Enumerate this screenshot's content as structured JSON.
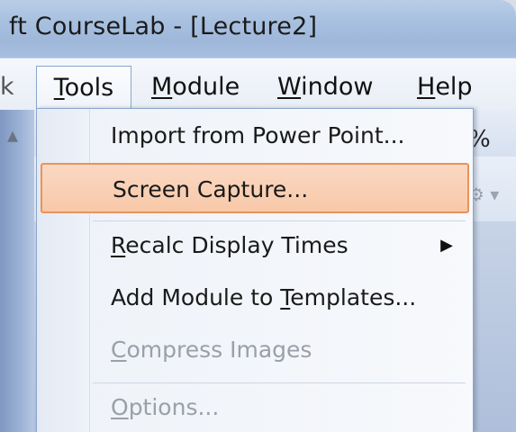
{
  "window": {
    "title": "ft CourseLab - [Lecture2]"
  },
  "menubar": {
    "left_stub": "k",
    "items": [
      {
        "id": "tools",
        "label_ul": "T",
        "label_rest": "ools"
      },
      {
        "id": "module",
        "label_ul": "M",
        "label_rest": "odule"
      },
      {
        "id": "window",
        "label_ul": "W",
        "label_rest": "indow"
      },
      {
        "id": "help",
        "label_ul": "H",
        "label_rest": "elp"
      }
    ]
  },
  "toolbar": {
    "left_stub": "▴",
    "percent_stub": "%",
    "right_icon_stub": "⚙ ▾"
  },
  "dropdown": {
    "items": [
      {
        "id": "import",
        "pre": "Import from Power Point...",
        "ul": "",
        "post": "",
        "enabled": true,
        "selected": false,
        "submenu": false
      },
      {
        "id": "screen-capture",
        "pre": "Screen Capture...",
        "ul": "",
        "post": "",
        "enabled": true,
        "selected": true,
        "submenu": false
      },
      {
        "id": "recalc",
        "pre": "",
        "ul": "R",
        "post": "ecalc Display Times",
        "enabled": true,
        "selected": false,
        "submenu": true
      },
      {
        "id": "add-module",
        "pre": "Add Module to ",
        "ul": "T",
        "post": "emplates...",
        "enabled": true,
        "selected": false,
        "submenu": false
      },
      {
        "id": "compress",
        "pre": "",
        "ul": "C",
        "post": "ompress Images",
        "enabled": false,
        "selected": false,
        "submenu": false
      },
      {
        "id": "options",
        "pre": "",
        "ul": "O",
        "post": "ptions...",
        "enabled": false,
        "selected": false,
        "submenu": false
      }
    ],
    "submenu_arrow": "▶"
  },
  "colors": {
    "highlight_fill": "#f8c9a8",
    "highlight_border": "#e9935a",
    "disabled_text": "#9a9fa8"
  }
}
